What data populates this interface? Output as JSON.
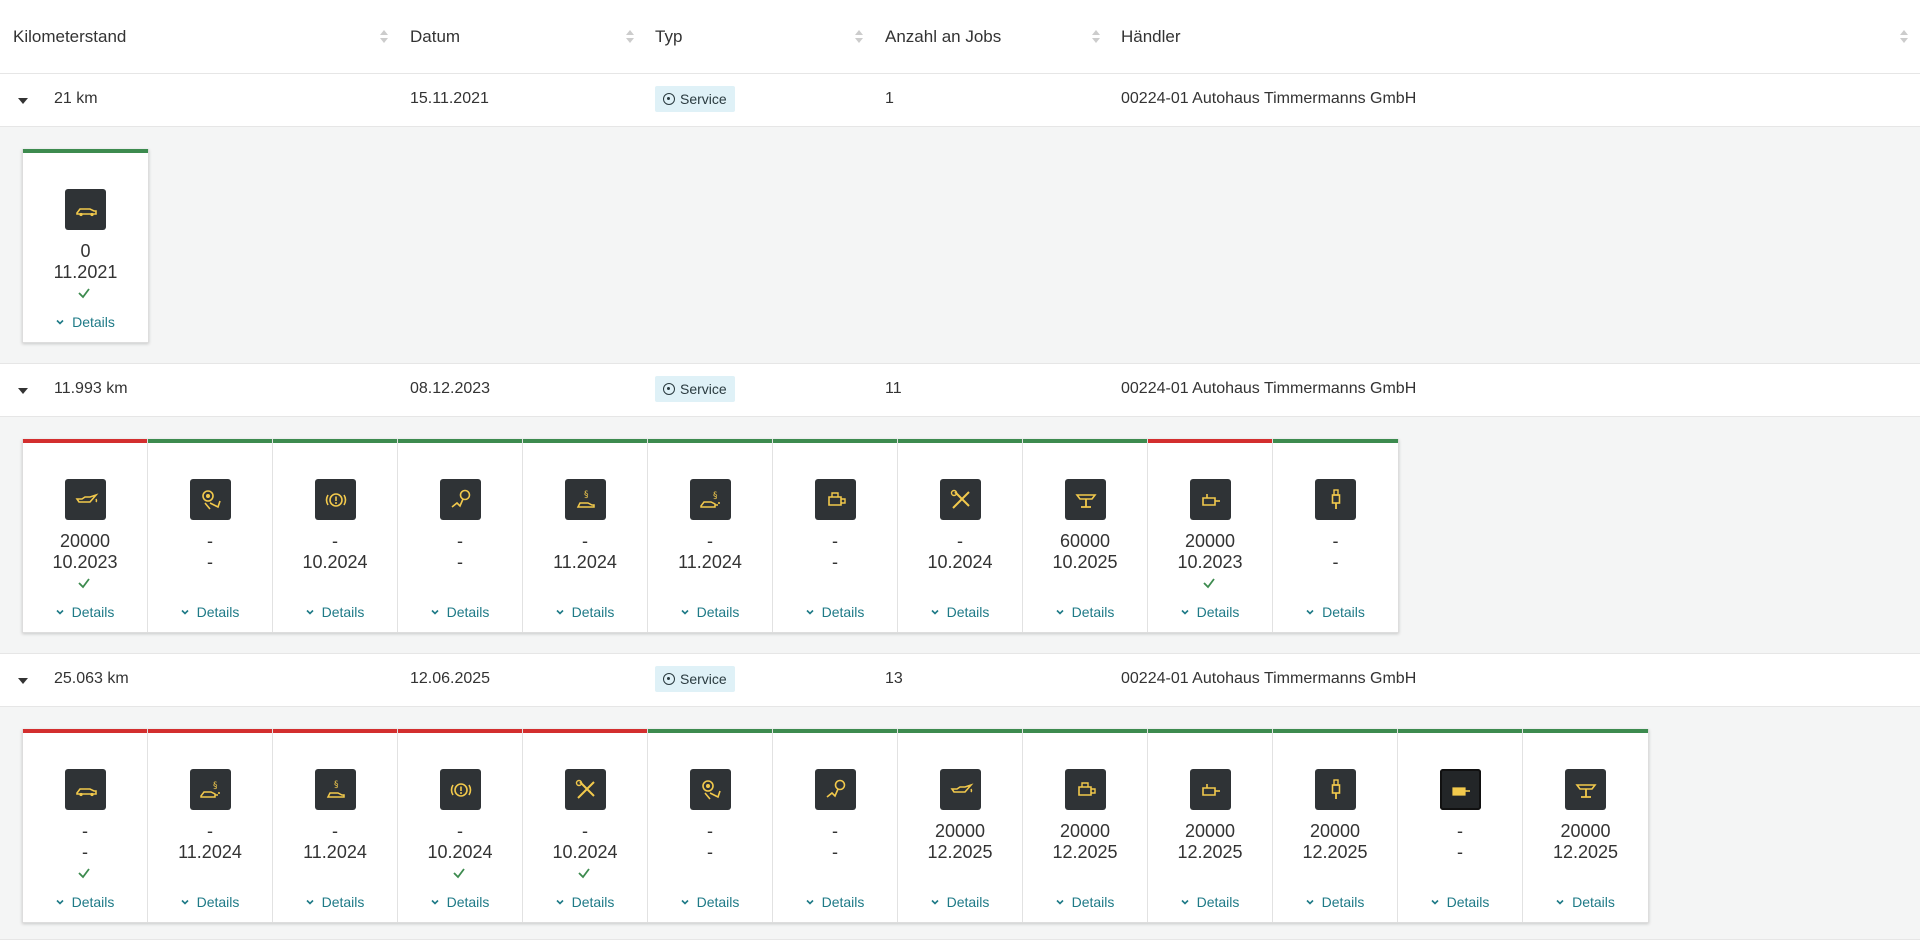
{
  "header": {
    "km": "Kilometerstand",
    "date": "Datum",
    "type": "Typ",
    "jobs": "Anzahl an Jobs",
    "dealer": "Händler"
  },
  "colors": {
    "ok": "#3d8b4f",
    "due": "#d32f2f",
    "icon_yellow": "#f2c94c"
  },
  "entries": [
    {
      "km": "21 km",
      "date": "15.11.2021",
      "type": "Service",
      "jobs": "1",
      "dealer": "00224-01 Autohaus Timmermanns GmbH",
      "jobs_list": [
        {
          "icon": "car-icon",
          "v1": "0",
          "v2": "11.2021",
          "check": true,
          "status": "ok",
          "details": "Details"
        }
      ]
    },
    {
      "km": "11.993 km",
      "date": "08.12.2023",
      "type": "Service",
      "jobs": "11",
      "dealer": "00224-01 Autohaus Timmermanns GmbH",
      "jobs_list": [
        {
          "icon": "oil-can-icon",
          "v1": "20000",
          "v2": "10.2023",
          "check": true,
          "status": "due",
          "details": "Details"
        },
        {
          "icon": "brake-wear-icon",
          "v1": "-",
          "v2": "-",
          "check": false,
          "status": "ok",
          "details": "Details"
        },
        {
          "icon": "brake-warning-icon",
          "v1": "-",
          "v2": "10.2024",
          "check": false,
          "status": "ok",
          "details": "Details"
        },
        {
          "icon": "brake-fluid-icon",
          "v1": "-",
          "v2": "-",
          "check": false,
          "status": "ok",
          "details": "Details"
        },
        {
          "icon": "inspection-law-icon",
          "v1": "-",
          "v2": "11.2024",
          "check": false,
          "status": "ok",
          "details": "Details"
        },
        {
          "icon": "exhaust-law-icon",
          "v1": "-",
          "v2": "11.2024",
          "check": false,
          "status": "ok",
          "details": "Details"
        },
        {
          "icon": "filter-icon",
          "v1": "-",
          "v2": "-",
          "check": false,
          "status": "ok",
          "details": "Details"
        },
        {
          "icon": "tools-icon",
          "v1": "-",
          "v2": "10.2024",
          "check": false,
          "status": "ok",
          "details": "Details"
        },
        {
          "icon": "lift-icon",
          "v1": "60000",
          "v2": "10.2025",
          "check": false,
          "status": "ok",
          "details": "Details"
        },
        {
          "icon": "fuel-filter-icon",
          "v1": "20000",
          "v2": "10.2023",
          "check": true,
          "status": "due",
          "details": "Details"
        },
        {
          "icon": "spark-plug-icon",
          "v1": "-",
          "v2": "-",
          "check": false,
          "status": "ok",
          "details": "Details"
        }
      ]
    },
    {
      "km": "25.063 km",
      "date": "12.06.2025",
      "type": "Service",
      "jobs": "13",
      "dealer": "00224-01 Autohaus Timmermanns GmbH",
      "jobs_list": [
        {
          "icon": "car-icon",
          "v1": "-",
          "v2": "-",
          "check": true,
          "status": "due",
          "details": "Details"
        },
        {
          "icon": "exhaust-law-icon",
          "v1": "-",
          "v2": "11.2024",
          "check": false,
          "status": "due",
          "details": "Details"
        },
        {
          "icon": "inspection-law-icon",
          "v1": "-",
          "v2": "11.2024",
          "check": false,
          "status": "due",
          "details": "Details"
        },
        {
          "icon": "brake-warning-icon",
          "v1": "-",
          "v2": "10.2024",
          "check": true,
          "status": "due",
          "details": "Details"
        },
        {
          "icon": "tools-icon",
          "v1": "-",
          "v2": "10.2024",
          "check": true,
          "status": "due",
          "details": "Details"
        },
        {
          "icon": "brake-wear-icon",
          "v1": "-",
          "v2": "-",
          "check": false,
          "status": "ok",
          "details": "Details"
        },
        {
          "icon": "brake-fluid-icon",
          "v1": "-",
          "v2": "-",
          "check": false,
          "status": "ok",
          "details": "Details"
        },
        {
          "icon": "oil-can-icon",
          "v1": "20000",
          "v2": "12.2025",
          "check": false,
          "status": "ok",
          "details": "Details"
        },
        {
          "icon": "filter-icon",
          "v1": "20000",
          "v2": "12.2025",
          "check": false,
          "status": "ok",
          "details": "Details"
        },
        {
          "icon": "fuel-filter-icon",
          "v1": "20000",
          "v2": "12.2025",
          "check": false,
          "status": "ok",
          "details": "Details"
        },
        {
          "icon": "spark-plug-icon",
          "v1": "20000",
          "v2": "12.2025",
          "check": false,
          "status": "ok",
          "details": "Details"
        },
        {
          "icon": "fuel-filter-framed-icon",
          "v1": "-",
          "v2": "-",
          "check": false,
          "status": "ok",
          "details": "Details"
        },
        {
          "icon": "lift-icon",
          "v1": "20000",
          "v2": "12.2025",
          "check": false,
          "status": "ok",
          "details": "Details"
        }
      ]
    }
  ]
}
